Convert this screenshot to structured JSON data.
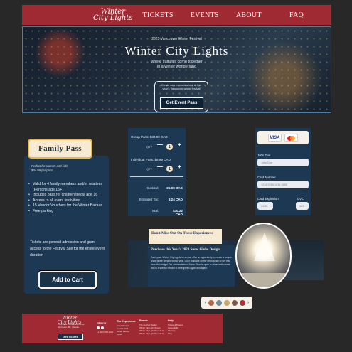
{
  "header": {
    "logo_line1": "Winter",
    "logo_line2": "City Lights",
    "nav": [
      "TICKETS",
      "EVENTS",
      "ABOUT",
      "FAQ"
    ]
  },
  "hero": {
    "kicker": "2023 Vancouver Winter Festival",
    "title": "Winter City Lights",
    "subtitle_line1": "where cultures come together",
    "subtitle_line2": "in a winter wonderland",
    "ticket_note_line1": "Create new memories now at this",
    "ticket_note_line2": "year's Vancouver winter festival",
    "button": "Get Event Pass"
  },
  "family_pass": {
    "title": "Family Pass",
    "note_line1": "Perfect for parents and kids",
    "note_line2": "$34.99 per pass",
    "features": [
      "Valid for 4 family members and/or relatives (Persons age 16+)",
      "Includes pass for children below age 16",
      "Access to all event festivities",
      "15 Vendor Vouchers for the Winter Bazaar",
      "Free parking"
    ],
    "description": "Tickets are general admission and grant access to the Festival Site for the entire event duration",
    "button": "Add to Cart"
  },
  "calculator": {
    "group_label": "Group Pass: $34.99 CAD",
    "individual_label": "Individual Pass: $8.99 CAD",
    "qty_label": "QTY",
    "group_qty": "1",
    "individual_qty": "1",
    "minus": "—",
    "plus": "+",
    "subtotal_label": "Subtotal:",
    "subtotal_value": "26.98 CAD",
    "tax_label": "Estimated Tax:",
    "tax_value": "3.24 CAD",
    "total_label": "Total:",
    "total_value": "$30.22 CAD"
  },
  "payment": {
    "visa": "VISA",
    "name_label": "John Doe",
    "name_placeholder": "John Doe",
    "card_label": "Card Number",
    "card_placeholder": "1234 5555 1234 5555",
    "expiry_label": "Card Expiration",
    "expiry_placeholder": "01/30",
    "cvc_label": "CVC",
    "cvc_placeholder": "123"
  },
  "collage": {
    "notice": "Don't Miss Out On These Experiences",
    "story_title": "Purchase this Year's 2023 Snow Globe Design",
    "story_body": "Each year, Winter City Lights is run, we offer an opportunity to create a unique snow globe specific to that year. Don't miss out on the opportunity to get this beautiful design! Our art installation, Snow-Glow is open to all art enthusiasts and is a special reward to be enjoyed again and again.",
    "carousel_prev": "‹",
    "carousel_next": "›"
  },
  "footer": {
    "logo_line1": "Winter",
    "logo_line2": "City Lights",
    "address_line1": "Trout Lake Community Centre",
    "address_line2": "Vancouver, BC, Canada",
    "follow_label": "Follow Us",
    "phone": "+1 (604) 555-0123",
    "cta": "Get Tickets",
    "col1_head": "The Experience",
    "col1_items": [
      "Entertainment",
      "Food & Drink",
      "Winter Bazaar",
      "Lights"
    ],
    "col2_head": "Events",
    "col2_items": [
      "The Festival Market",
      "Winter City Light Shows",
      "Winter City Light Rave Fest",
      "Winter City Light Rave Fest"
    ],
    "col3_head": "Help",
    "col3_items": [
      "Tickets & Passes",
      "Accessibility",
      "Sitemap",
      "FAQ"
    ]
  },
  "colors": {
    "brand_red": "#9f2a33",
    "navy": "#1d3853",
    "cream": "#f7ead2",
    "gold": "#e3b94d",
    "background": "#282828"
  }
}
